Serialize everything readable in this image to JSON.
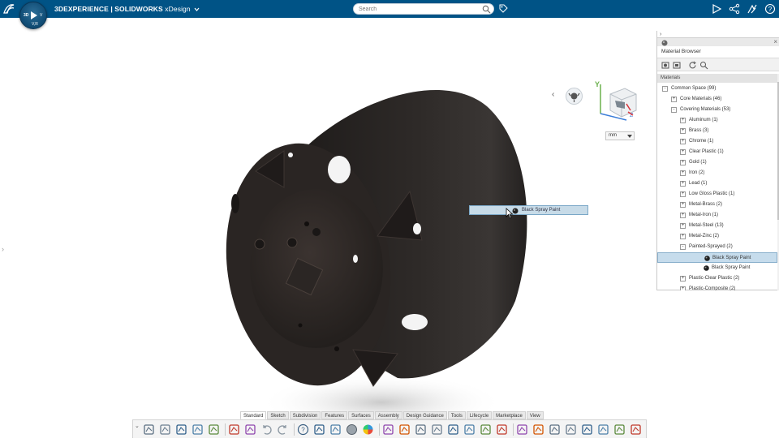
{
  "header": {
    "brand_main": "3DEXPERIENCE | SOLIDWORKS",
    "brand_app": "xDesign",
    "compass_left": "3D",
    "compass_right": "V",
    "compass_bottom": "V,R",
    "search_placeholder": "Search",
    "right_icons": [
      "share-play-icon",
      "share-icon",
      "collab-icon",
      "help-icon"
    ]
  },
  "viewport": {
    "unit": "mm",
    "axis_y": "Y",
    "axis_z": "Z",
    "drag_label": "Black Spray Paint",
    "part_color": "#2b2624"
  },
  "material_browser": {
    "title": "Material Browser",
    "section": "Materials",
    "tree": [
      {
        "label": "Common Space (99)",
        "level": 0,
        "toggle": "-"
      },
      {
        "label": "Core Materials (46)",
        "level": 1,
        "toggle": "+"
      },
      {
        "label": "Covering Materials (53)",
        "level": 1,
        "toggle": "-"
      },
      {
        "label": "Aluminum (1)",
        "level": 2,
        "toggle": "+"
      },
      {
        "label": "Brass (3)",
        "level": 2,
        "toggle": "+"
      },
      {
        "label": "Chrome (1)",
        "level": 2,
        "toggle": "+"
      },
      {
        "label": "Clear Plastic (1)",
        "level": 2,
        "toggle": "+"
      },
      {
        "label": "Gold (1)",
        "level": 2,
        "toggle": "+"
      },
      {
        "label": "Iron (2)",
        "level": 2,
        "toggle": "+"
      },
      {
        "label": "Lead (1)",
        "level": 2,
        "toggle": "+"
      },
      {
        "label": "Low Gloss Plastic (1)",
        "level": 2,
        "toggle": "+"
      },
      {
        "label": "Metal-Brass (2)",
        "level": 2,
        "toggle": "+"
      },
      {
        "label": "Metal-Iron (1)",
        "level": 2,
        "toggle": "+"
      },
      {
        "label": "Metal-Steel (13)",
        "level": 2,
        "toggle": "+"
      },
      {
        "label": "Metal-Zinc (2)",
        "level": 2,
        "toggle": "+"
      },
      {
        "label": "Painted-Sprayed (2)",
        "level": 2,
        "toggle": "-"
      },
      {
        "label": "Black Spray Paint",
        "level": 3,
        "toggle": "",
        "selected": true
      },
      {
        "label": "Black Spray Paint",
        "level": 3,
        "toggle": ""
      },
      {
        "label": "Plastic-Clear Plastic (2)",
        "level": 2,
        "toggle": "+"
      },
      {
        "label": "Plastic-Composite (2)",
        "level": 2,
        "toggle": "+"
      }
    ]
  },
  "tabs": [
    "Standard",
    "Sketch",
    "Subdivision",
    "Features",
    "Surfaces",
    "Assembly",
    "Design Guidance",
    "Tools",
    "Lifecycle",
    "Marketplace",
    "View"
  ],
  "active_tab": "Standard",
  "toolbar_icons": [
    "new-icon",
    "open-icon",
    "save-icon",
    "save-as-icon",
    "refresh-icon",
    "properties-icon",
    "settings-icon",
    "undo-icon",
    "redo-icon",
    "help-icon",
    "lasso-icon",
    "capture-icon",
    "appearance-icon",
    "color-wheel-icon",
    "zoom-fit-icon",
    "render-icon",
    "section-icon",
    "view-icon",
    "measure-icon",
    "mass-icon",
    "plane-icon",
    "pattern-icon",
    "checker-icon",
    "dimension-icon",
    "report-icon",
    "view3d-icon",
    "share-arrow-icon",
    "filter-icon",
    "compare-icon",
    "export-icon"
  ],
  "colors": {
    "topbar": "#005386",
    "selection": "#c6dcec"
  }
}
